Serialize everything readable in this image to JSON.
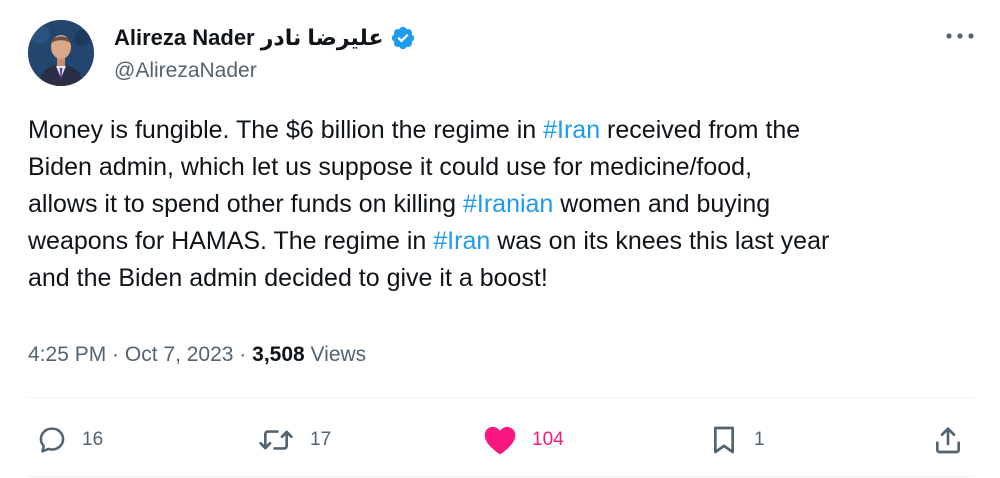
{
  "author": {
    "display_name": "Alireza Nader عليرضا نادر",
    "handle": "@AlirezaNader",
    "verified_icon": "verified-badge-icon",
    "avatar_colors": {
      "bg": "#23466f",
      "skin": "#d9a98a",
      "suit": "#2a2f45"
    }
  },
  "tweet": {
    "lines": [
      [
        {
          "t": "Money is fungible. The $6 billion the regime in "
        },
        {
          "t": "#Iran",
          "tag": true
        },
        {
          "t": " received from the"
        }
      ],
      [
        {
          "t": "Biden admin, which let us suppose it could use for medicine/food,"
        }
      ],
      [
        {
          "t": "allows it to spend other funds on killing "
        },
        {
          "t": "#Iranian",
          "tag": true
        },
        {
          "t": " women and buying"
        }
      ],
      [
        {
          "t": "weapons for HAMAS. The regime in "
        },
        {
          "t": "#Iran",
          "tag": true
        },
        {
          "t": " was on its knees this last year"
        }
      ],
      [
        {
          "t": "and the Biden admin decided to give it a boost!"
        }
      ]
    ]
  },
  "meta": {
    "time": "4:25 PM",
    "sep1": " · ",
    "date": "Oct 7, 2023",
    "sep2": " · ",
    "views_count": "3,508",
    "views_label": " Views"
  },
  "actions": {
    "replies": "16",
    "retweets": "17",
    "likes": "104",
    "bookmarks": "1"
  },
  "colors": {
    "accent": "#1d9bf0",
    "like": "#f91880",
    "muted": "#536471",
    "text": "#0f1419",
    "divider": "#eff3f4"
  }
}
